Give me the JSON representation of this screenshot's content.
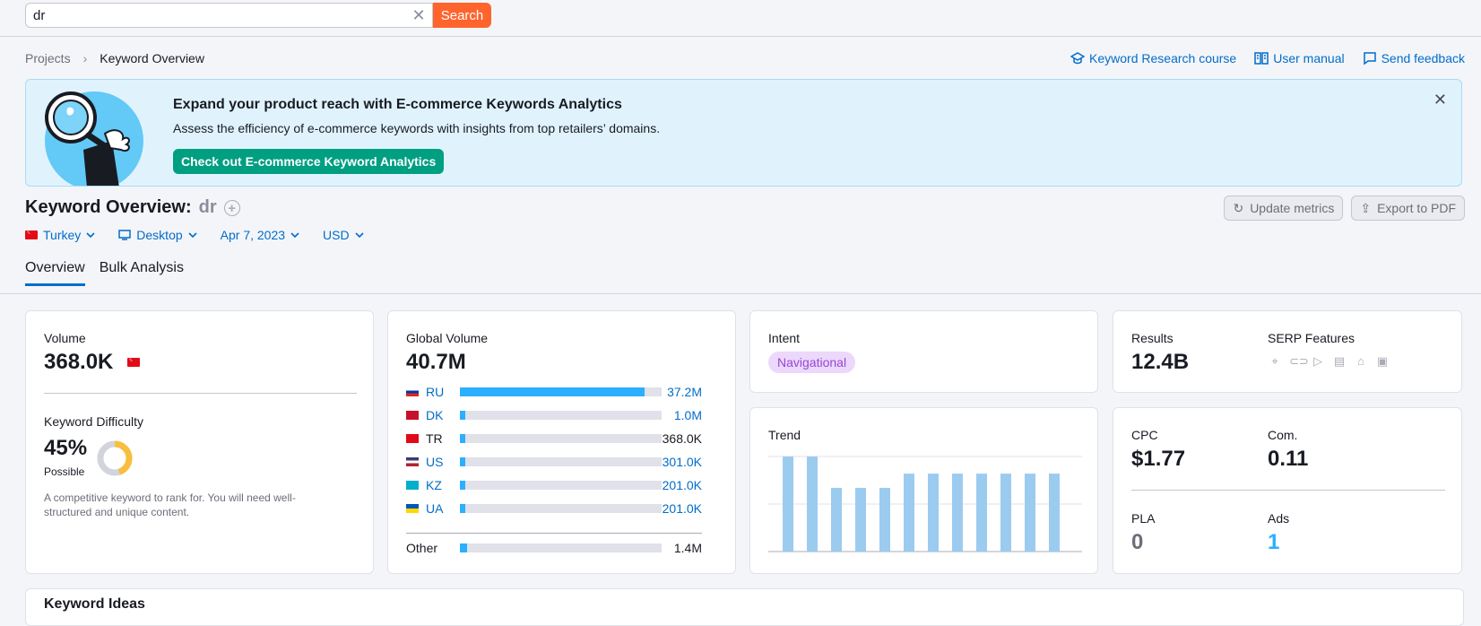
{
  "search": {
    "value": "dr",
    "button": "Search"
  },
  "breadcrumb": {
    "projects": "Projects",
    "current": "Keyword Overview"
  },
  "header_links": {
    "course": "Keyword Research course",
    "manual": "User manual",
    "feedback": "Send feedback"
  },
  "banner": {
    "title": "Expand your product reach with E-commerce Keywords Analytics",
    "text": "Assess the efficiency of e-commerce keywords with insights from top retailers’ domains.",
    "cta": "Check out E-commerce Keyword Analytics"
  },
  "title": {
    "label": "Keyword Overview:",
    "keyword": "dr"
  },
  "actions": {
    "update": "Update metrics",
    "export": "Export to PDF"
  },
  "filters": {
    "country": "Turkey",
    "device": "Desktop",
    "date": "Apr 7, 2023",
    "currency": "USD"
  },
  "tabs": {
    "overview": "Overview",
    "bulk": "Bulk Analysis"
  },
  "volume": {
    "label": "Volume",
    "value": "368.0K"
  },
  "difficulty": {
    "label": "Keyword Difficulty",
    "value": "45%",
    "percent": 45,
    "level": "Possible",
    "description": "A competitive keyword to rank for. You will need well-structured and unique content."
  },
  "global_volume": {
    "label": "Global Volume",
    "value": "40.7M",
    "countries": [
      {
        "code": "RU",
        "value": "37.2M",
        "share": 0.914,
        "link": true
      },
      {
        "code": "DK",
        "value": "1.0M",
        "share": 0.025,
        "link": true
      },
      {
        "code": "TR",
        "value": "368.0K",
        "share": 0.009,
        "link": false
      },
      {
        "code": "US",
        "value": "301.0K",
        "share": 0.007,
        "link": true
      },
      {
        "code": "KZ",
        "value": "201.0K",
        "share": 0.005,
        "link": true
      },
      {
        "code": "UA",
        "value": "201.0K",
        "share": 0.005,
        "link": true
      }
    ],
    "other": {
      "label": "Other",
      "value": "1.4M",
      "share": 0.034
    }
  },
  "intent": {
    "label": "Intent",
    "value": "Navigational"
  },
  "results": {
    "label": "Results",
    "value": "12.4B"
  },
  "serp": {
    "label": "SERP Features",
    "icons": [
      "local-pack-icon",
      "sitelinks-icon",
      "video-icon",
      "article-icon",
      "knowledge-panel-icon",
      "ads-icon"
    ]
  },
  "trend": {
    "label": "Trend"
  },
  "chart_data": {
    "type": "bar",
    "title": "Trend",
    "values": [
      1.0,
      1.0,
      0.67,
      0.67,
      0.67,
      0.82,
      0.82,
      0.82,
      0.82,
      0.82,
      0.82,
      0.82
    ],
    "ylim": [
      0,
      1
    ],
    "grid": true
  },
  "cpc": {
    "label": "CPC",
    "value": "$1.77"
  },
  "com": {
    "label": "Com.",
    "value": "0.11"
  },
  "pla": {
    "label": "PLA",
    "value": "0"
  },
  "ads": {
    "label": "Ads",
    "value": "1"
  },
  "colors": {
    "accent": "#006dca",
    "search": "#ff642d",
    "cta": "#009f81",
    "bar": "#2bafff",
    "trend": "#9ccbf0",
    "kd": "#f8be3c"
  }
}
